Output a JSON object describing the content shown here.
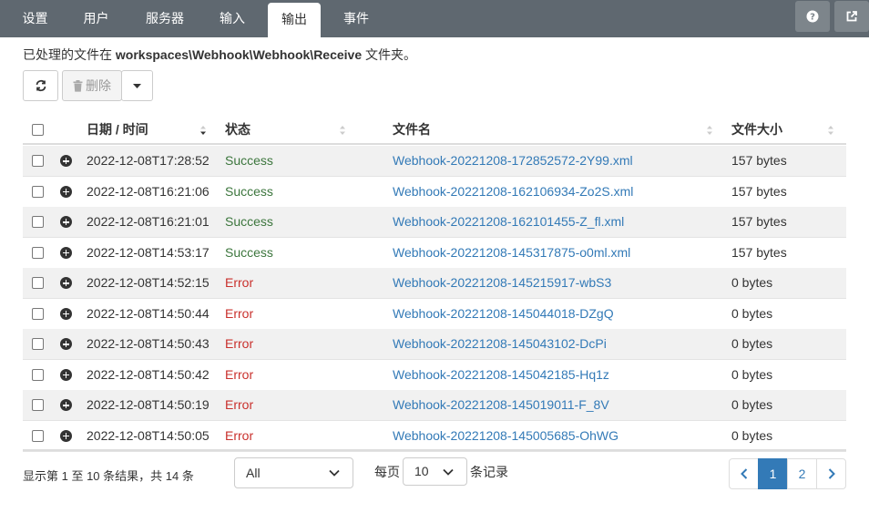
{
  "nav": {
    "tabs": [
      {
        "label": "设置"
      },
      {
        "label": "用户"
      },
      {
        "label": "服务器"
      },
      {
        "label": "输入"
      },
      {
        "label": "输出",
        "active": true
      },
      {
        "label": "事件"
      }
    ],
    "help_icon": "question-circle-icon",
    "external_icon": "external-link-icon"
  },
  "info": {
    "prefix": "已处理的文件在 ",
    "path": "workspaces\\Webhook\\Webhook\\Receive",
    "suffix": " 文件夹。"
  },
  "toolbar": {
    "refresh_icon": "refresh-icon",
    "delete_label": "删除",
    "delete_icon": "trash-icon",
    "dropdown_icon": "caret-down-icon"
  },
  "table": {
    "columns": {
      "date": "日期 / 时间",
      "status": "状态",
      "filename": "文件名",
      "size": "文件大小"
    },
    "rows": [
      {
        "date": "2022-12-08T17:28:52",
        "status": "Success",
        "filename": "Webhook-20221208-172852572-2Y99.xml",
        "size": "157 bytes"
      },
      {
        "date": "2022-12-08T16:21:06",
        "status": "Success",
        "filename": "Webhook-20221208-162106934-Zo2S.xml",
        "size": "157 bytes"
      },
      {
        "date": "2022-12-08T16:21:01",
        "status": "Success",
        "filename": "Webhook-20221208-162101455-Z_fl.xml",
        "size": "157 bytes"
      },
      {
        "date": "2022-12-08T14:53:17",
        "status": "Success",
        "filename": "Webhook-20221208-145317875-o0ml.xml",
        "size": "157 bytes"
      },
      {
        "date": "2022-12-08T14:52:15",
        "status": "Error",
        "filename": "Webhook-20221208-145215917-wbS3",
        "size": "0 bytes"
      },
      {
        "date": "2022-12-08T14:50:44",
        "status": "Error",
        "filename": "Webhook-20221208-145044018-DZgQ",
        "size": "0 bytes"
      },
      {
        "date": "2022-12-08T14:50:43",
        "status": "Error",
        "filename": "Webhook-20221208-145043102-DcPi",
        "size": "0 bytes"
      },
      {
        "date": "2022-12-08T14:50:42",
        "status": "Error",
        "filename": "Webhook-20221208-145042185-Hq1z",
        "size": "0 bytes"
      },
      {
        "date": "2022-12-08T14:50:19",
        "status": "Error",
        "filename": "Webhook-20221208-145019011-F_8V",
        "size": "0 bytes"
      },
      {
        "date": "2022-12-08T14:50:05",
        "status": "Error",
        "filename": "Webhook-20221208-145005685-OhWG",
        "size": "0 bytes"
      }
    ]
  },
  "footer": {
    "summary": "显示第 1 至 10 条结果，共 14 条",
    "filter_value": "All",
    "per_page_prefix": "每页",
    "per_page_value": "10",
    "per_page_suffix": "条记录",
    "pages": [
      "1",
      "2"
    ],
    "current_page": "1"
  },
  "colors": {
    "nav_bg": "#5f6870",
    "link": "#337ab7",
    "success": "#3c763d",
    "error": "#c9302c"
  }
}
